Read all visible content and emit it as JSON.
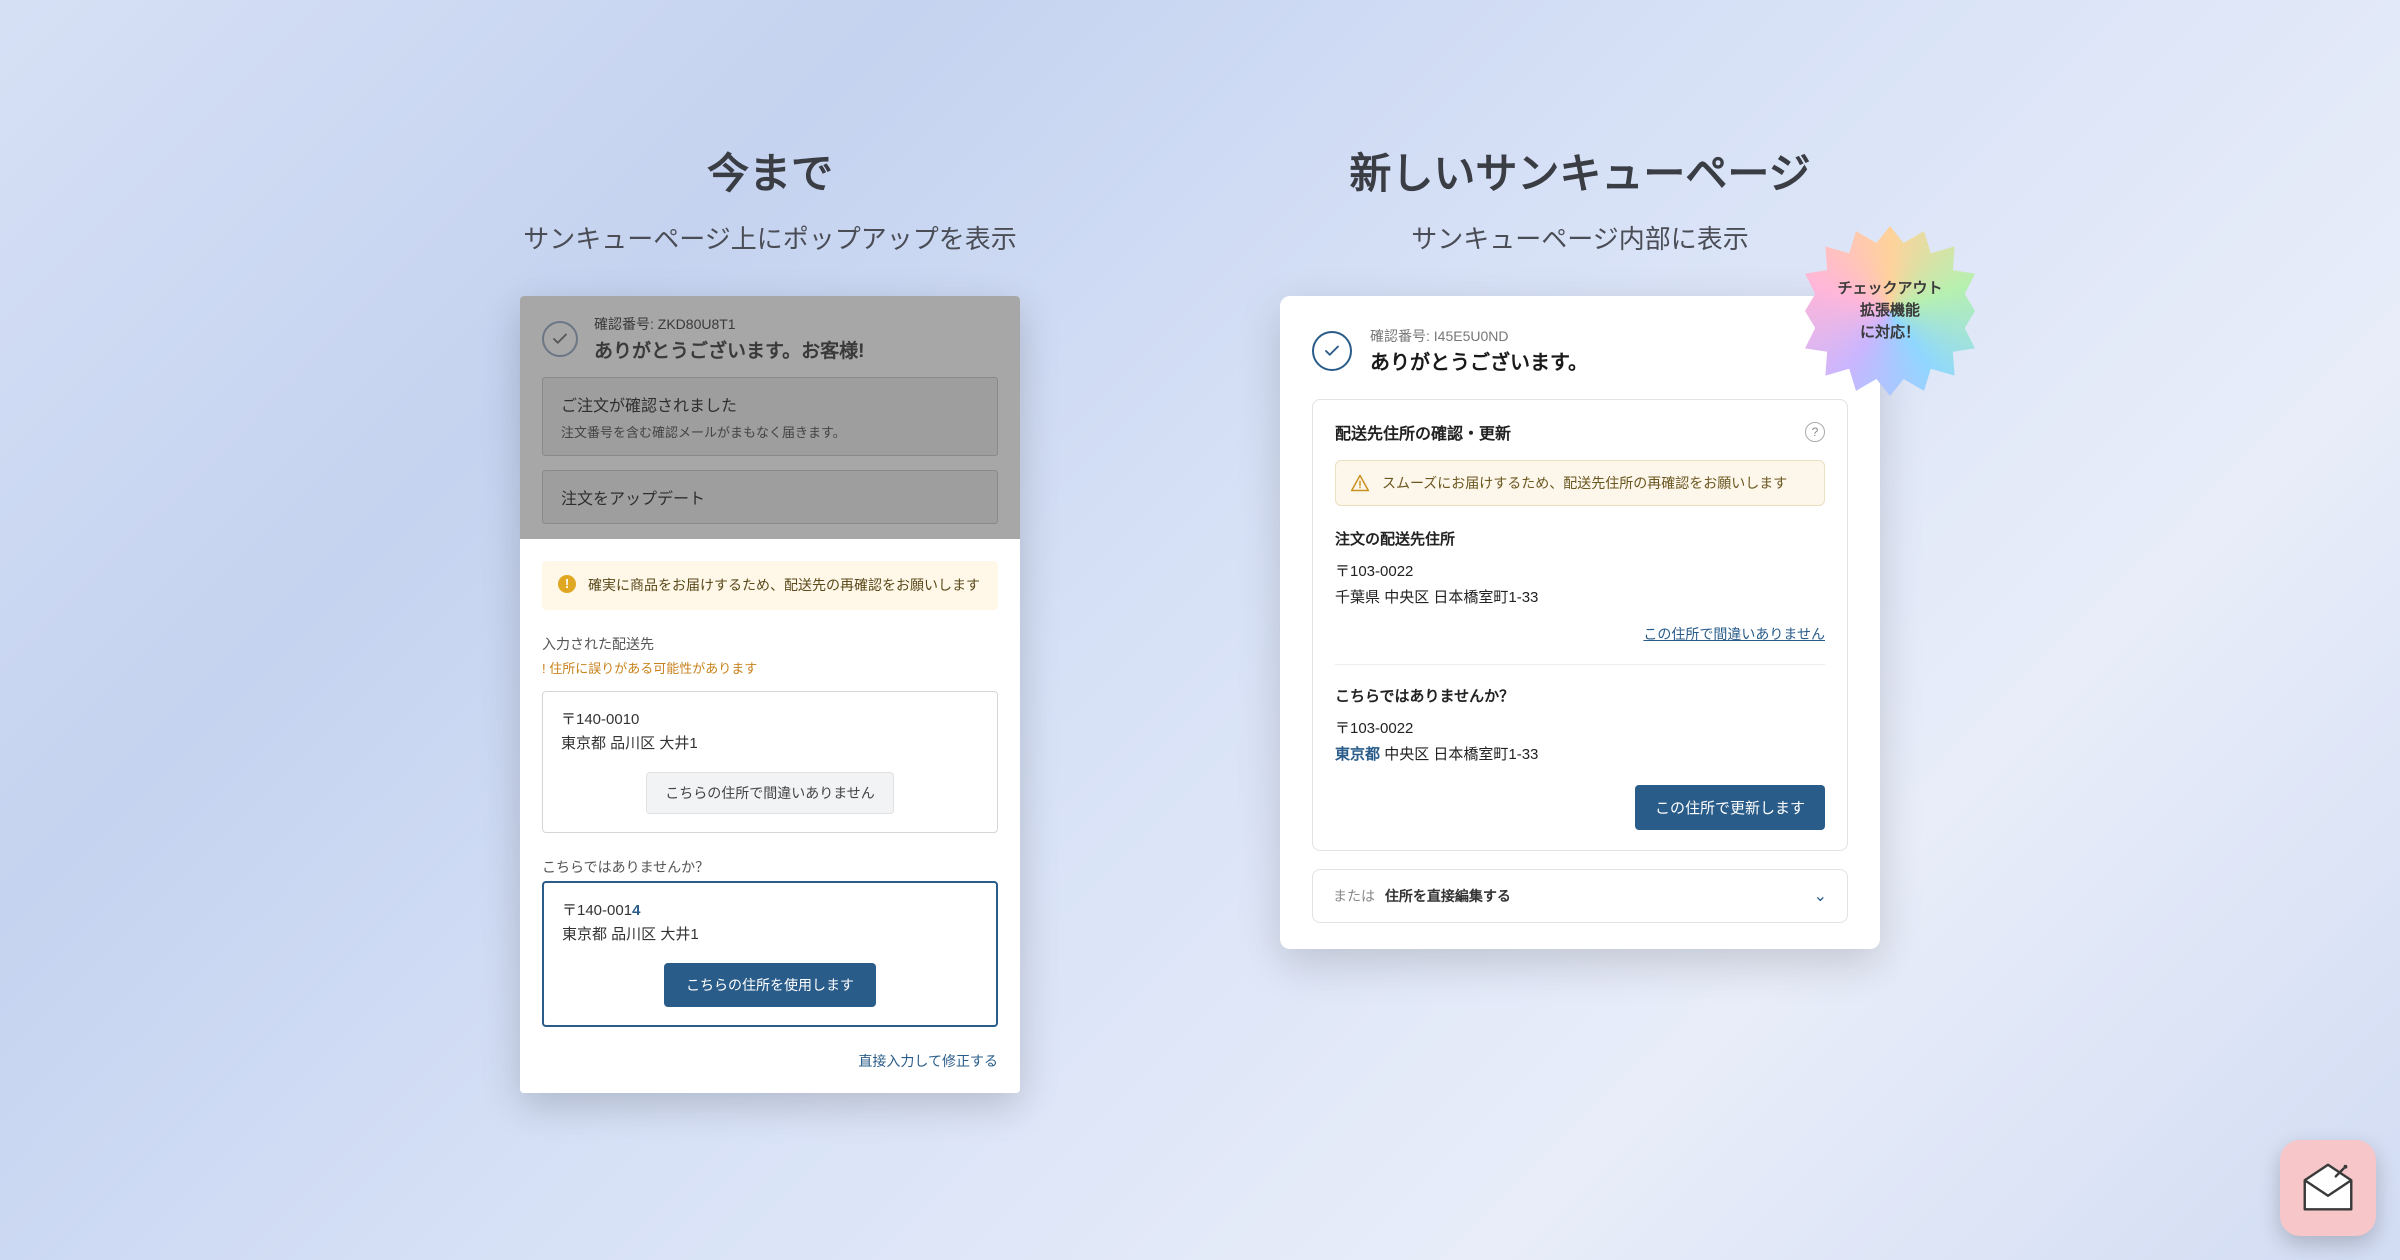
{
  "left": {
    "title": "今まで",
    "subtitle": "サンキューページ上にポップアップを表示",
    "confirmation_label": "確認番号: ZKD80U8T1",
    "thanks": "ありがとうございます。お客様!",
    "order_confirmed_title": "ご注文が確認されました",
    "order_confirmed_sub": "注文番号を含む確認メールがまもなく届きます。",
    "order_update_title": "注文をアップデート",
    "warning": "確実に商品をお届けするため、配送先の再確認をお願いします",
    "entered_label": "入力された配送先",
    "entered_warning": "! 住所に誤りがある可能性があります",
    "postal1": "〒140-0010",
    "addr1": "東京都 品川区 大井1",
    "btn_confirm": "こちらの住所で間違いありません",
    "suggest_label": "こちらではありませんか？",
    "postal2_prefix": "〒140-001",
    "postal2_hl": "4",
    "addr2": "東京都 品川区 大井1",
    "btn_use": "こちらの住所を使用します",
    "link_manual": "直接入力して修正する"
  },
  "right": {
    "title": "新しいサンキューページ",
    "subtitle": "サンキューページ内部に表示",
    "confirmation_label": "確認番号: I45E5U0ND",
    "thanks": "ありがとうございます。",
    "panel_title": "配送先住所の確認・更新",
    "warning": "スムーズにお届けするため、配送先住所の再確認をお願いします",
    "section_order_addr": "注文の配送先住所",
    "postal1": "〒103-0022",
    "addr1_a": "千葉県",
    "addr1_b": "中央区",
    "addr1_c": "日本橋室町1-33",
    "link_ok": "この住所で間違いありません",
    "section_suggest": "こちらではありませんか？",
    "postal2": "〒103-0022",
    "addr2_pref": "東京都",
    "addr2_b": "中央区",
    "addr2_c": "日本橋室町1-33",
    "btn_update": "この住所で更新します",
    "expander_lead": "または",
    "expander_label": "住所を直接編集する",
    "badge_l1": "チェックアウト",
    "badge_l2": "拡張機能",
    "badge_l3": "に対応！"
  }
}
